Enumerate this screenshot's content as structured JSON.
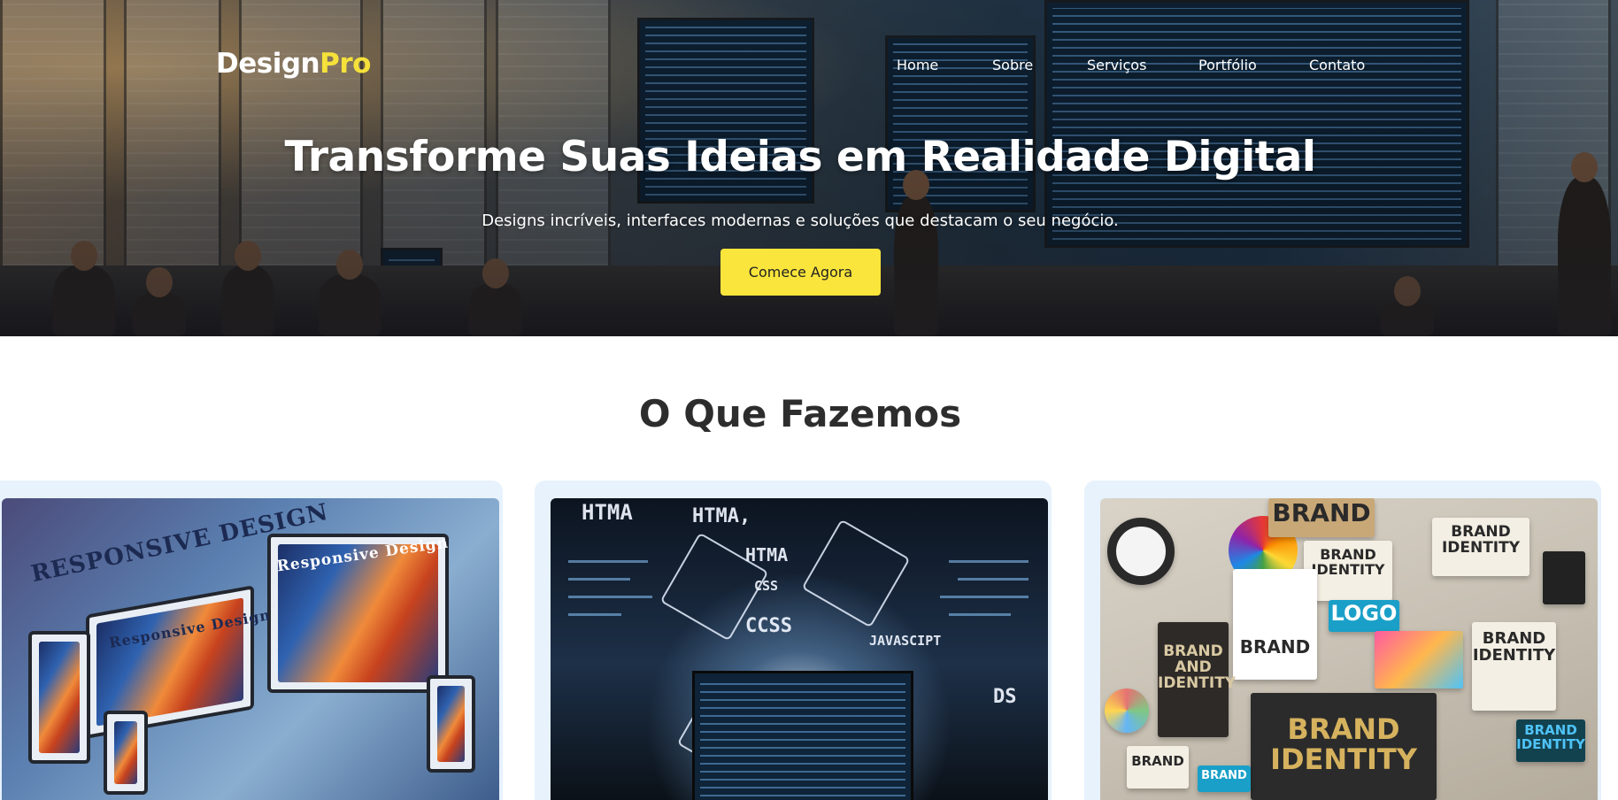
{
  "brand": {
    "name_main": "Design",
    "name_accent": "Pro"
  },
  "nav": {
    "items": [
      "Home",
      "Sobre",
      "Serviços",
      "Portfólio",
      "Contato"
    ]
  },
  "hero": {
    "title": "Transforme Suas Ideias em Realidade Digital",
    "subtitle": "Designs incríveis, interfaces modernas e soluções que destacam o seu negócio.",
    "cta_label": "Comece Agora"
  },
  "services": {
    "title": "O Que Fazemos",
    "cards": [
      {
        "image": "responsive-design-illustration",
        "texts": [
          "RESPONSIVE DESIGN",
          "Responsive Design",
          "Responsive Design"
        ]
      },
      {
        "image": "web-technologies-illustration",
        "texts": [
          "HTMA",
          "HTMA,",
          "HTMA",
          "CSS",
          "CCSS",
          "JAVASCIPT",
          "DS"
        ]
      },
      {
        "image": "brand-identity-flatlay",
        "texts": [
          "BRAND",
          "BRAND IDENTITY",
          "BRAND IDENTITY",
          "LOGO",
          "BRAND",
          "BRAND AND IDENTITY",
          "BRAND IDENTITY",
          "BRAND IDENTITY",
          "BRAND",
          "BRAND",
          "BRAND IDENTITY"
        ]
      }
    ]
  },
  "colors": {
    "accent": "#f9e53b",
    "card_bg": "#e7f2fd",
    "heading": "#2d2d2d"
  }
}
